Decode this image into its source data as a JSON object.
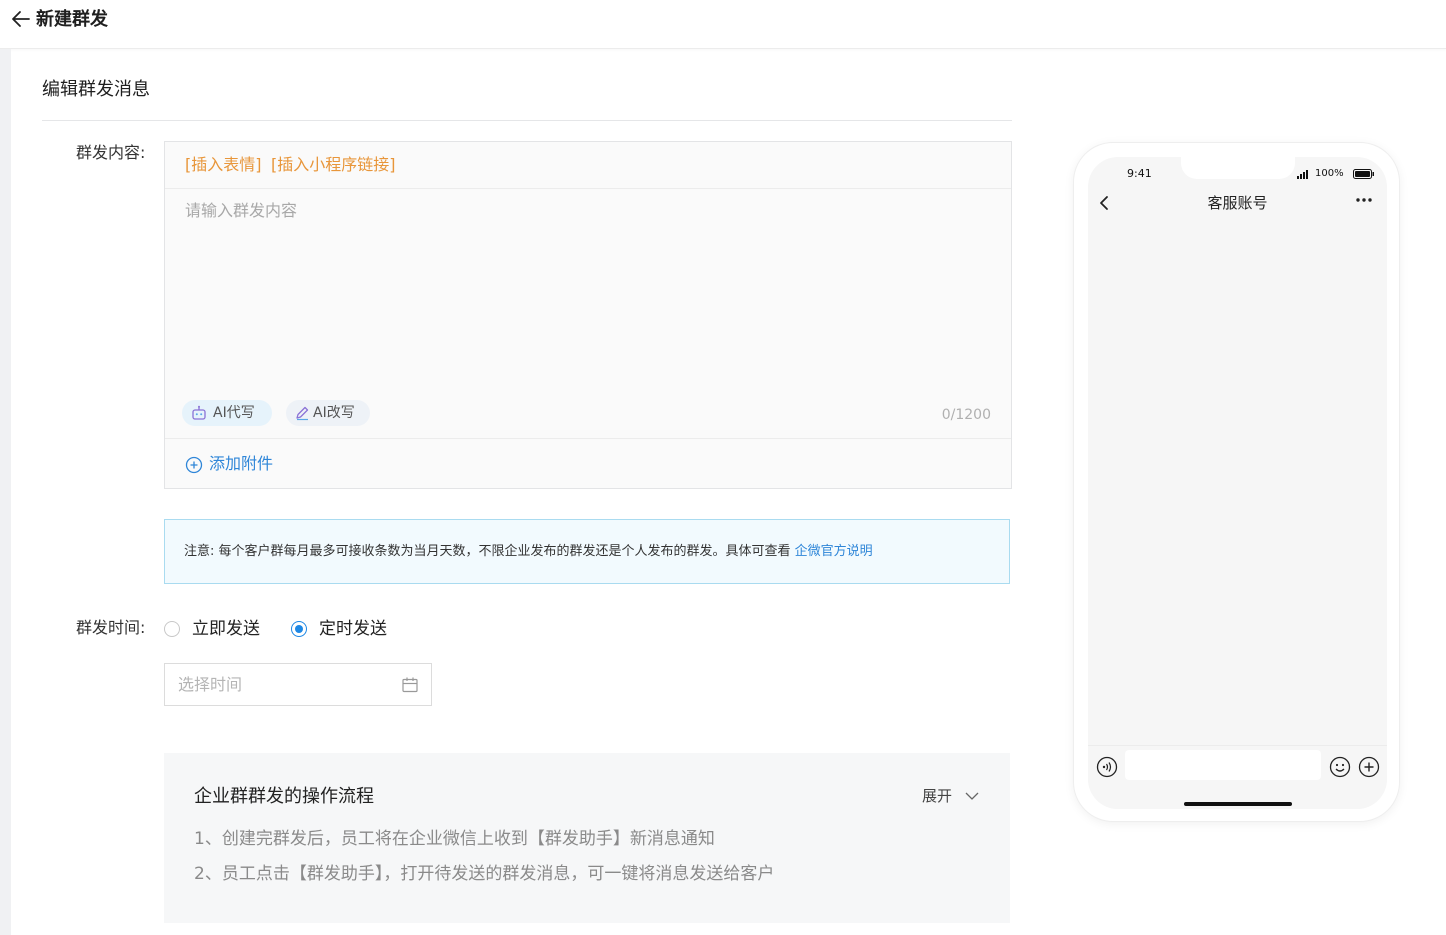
{
  "header": {
    "title": "新建群发"
  },
  "section": {
    "title": "编辑群发消息"
  },
  "content_field": {
    "label": "群发内容:",
    "insert_emoji": "[插入表情]",
    "insert_miniprogram": "[插入小程序链接]",
    "placeholder": "请输入群发内容",
    "ai_write": "AI代写",
    "ai_rewrite": "AI改写",
    "counter": "0/1200",
    "add_attachment": "添加附件"
  },
  "notice": {
    "text": "注意:  每个客户群每月最多可接收条数为当月天数，不限企业发布的群发还是个人发布的群发。具体可查看 ",
    "link": "企微官方说明"
  },
  "time_field": {
    "label": "群发时间:",
    "options": [
      {
        "label": "立即发送",
        "selected": false
      },
      {
        "label": "定时发送",
        "selected": true
      }
    ],
    "date_placeholder": "选择时间"
  },
  "flow": {
    "title": "企业群群发的操作流程",
    "expand_label": "展开",
    "steps": [
      "1、创建完群发后，员工将在企业微信上收到【群发助手】新消息通知",
      "2、员工点击【群发助手】，打开待发送的群发消息，可一键将消息发送给客户"
    ]
  },
  "phone": {
    "time": "9:41",
    "battery": "100%",
    "chat_title": "客服账号"
  },
  "colors": {
    "accent": "#1e88e5",
    "link": "#2f86d8",
    "insert": "#e8963a",
    "notice_border": "#a9dbf0"
  },
  "icons": [
    "arrow-left-icon",
    "robot-icon",
    "pen-icon",
    "plus-circle-icon",
    "calendar-icon",
    "chevron-down-icon",
    "chevron-left-icon",
    "more-dots-icon",
    "voice-icon",
    "emoji-icon",
    "plus-icon",
    "signal-icon",
    "battery-icon"
  ]
}
